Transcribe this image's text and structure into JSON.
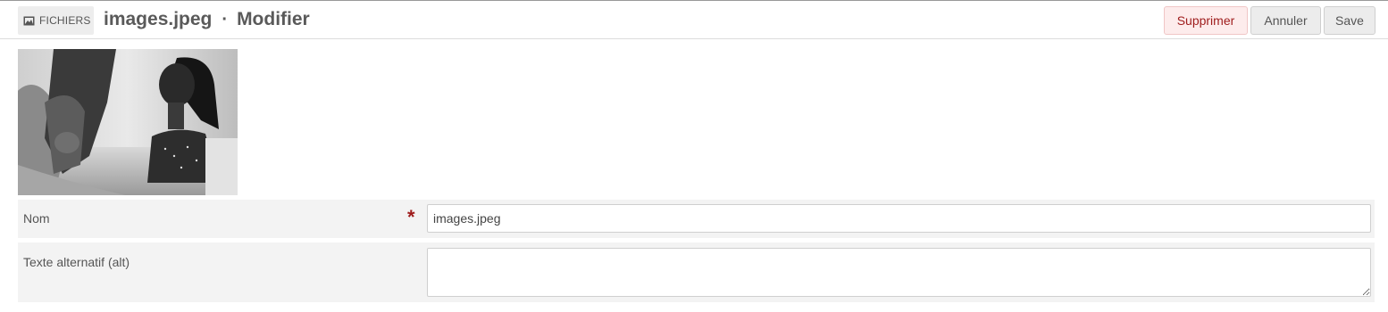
{
  "header": {
    "crumb_label": "FICHIERS",
    "crumb_icon": "image-icon",
    "file_name": "images.jpeg",
    "separator": "·",
    "action": "Modifier"
  },
  "toolbar": {
    "delete_label": "Supprimer",
    "cancel_label": "Annuler",
    "save_label": "Save"
  },
  "form": {
    "name_label": "Nom",
    "required_mark": "*",
    "name_value": "images.jpeg",
    "alt_label": "Texte alternatif (alt)",
    "alt_value": ""
  },
  "colors": {
    "danger": "#9e1b1b",
    "danger_bg": "#fdecec",
    "row_bg": "#f3f3f3"
  }
}
